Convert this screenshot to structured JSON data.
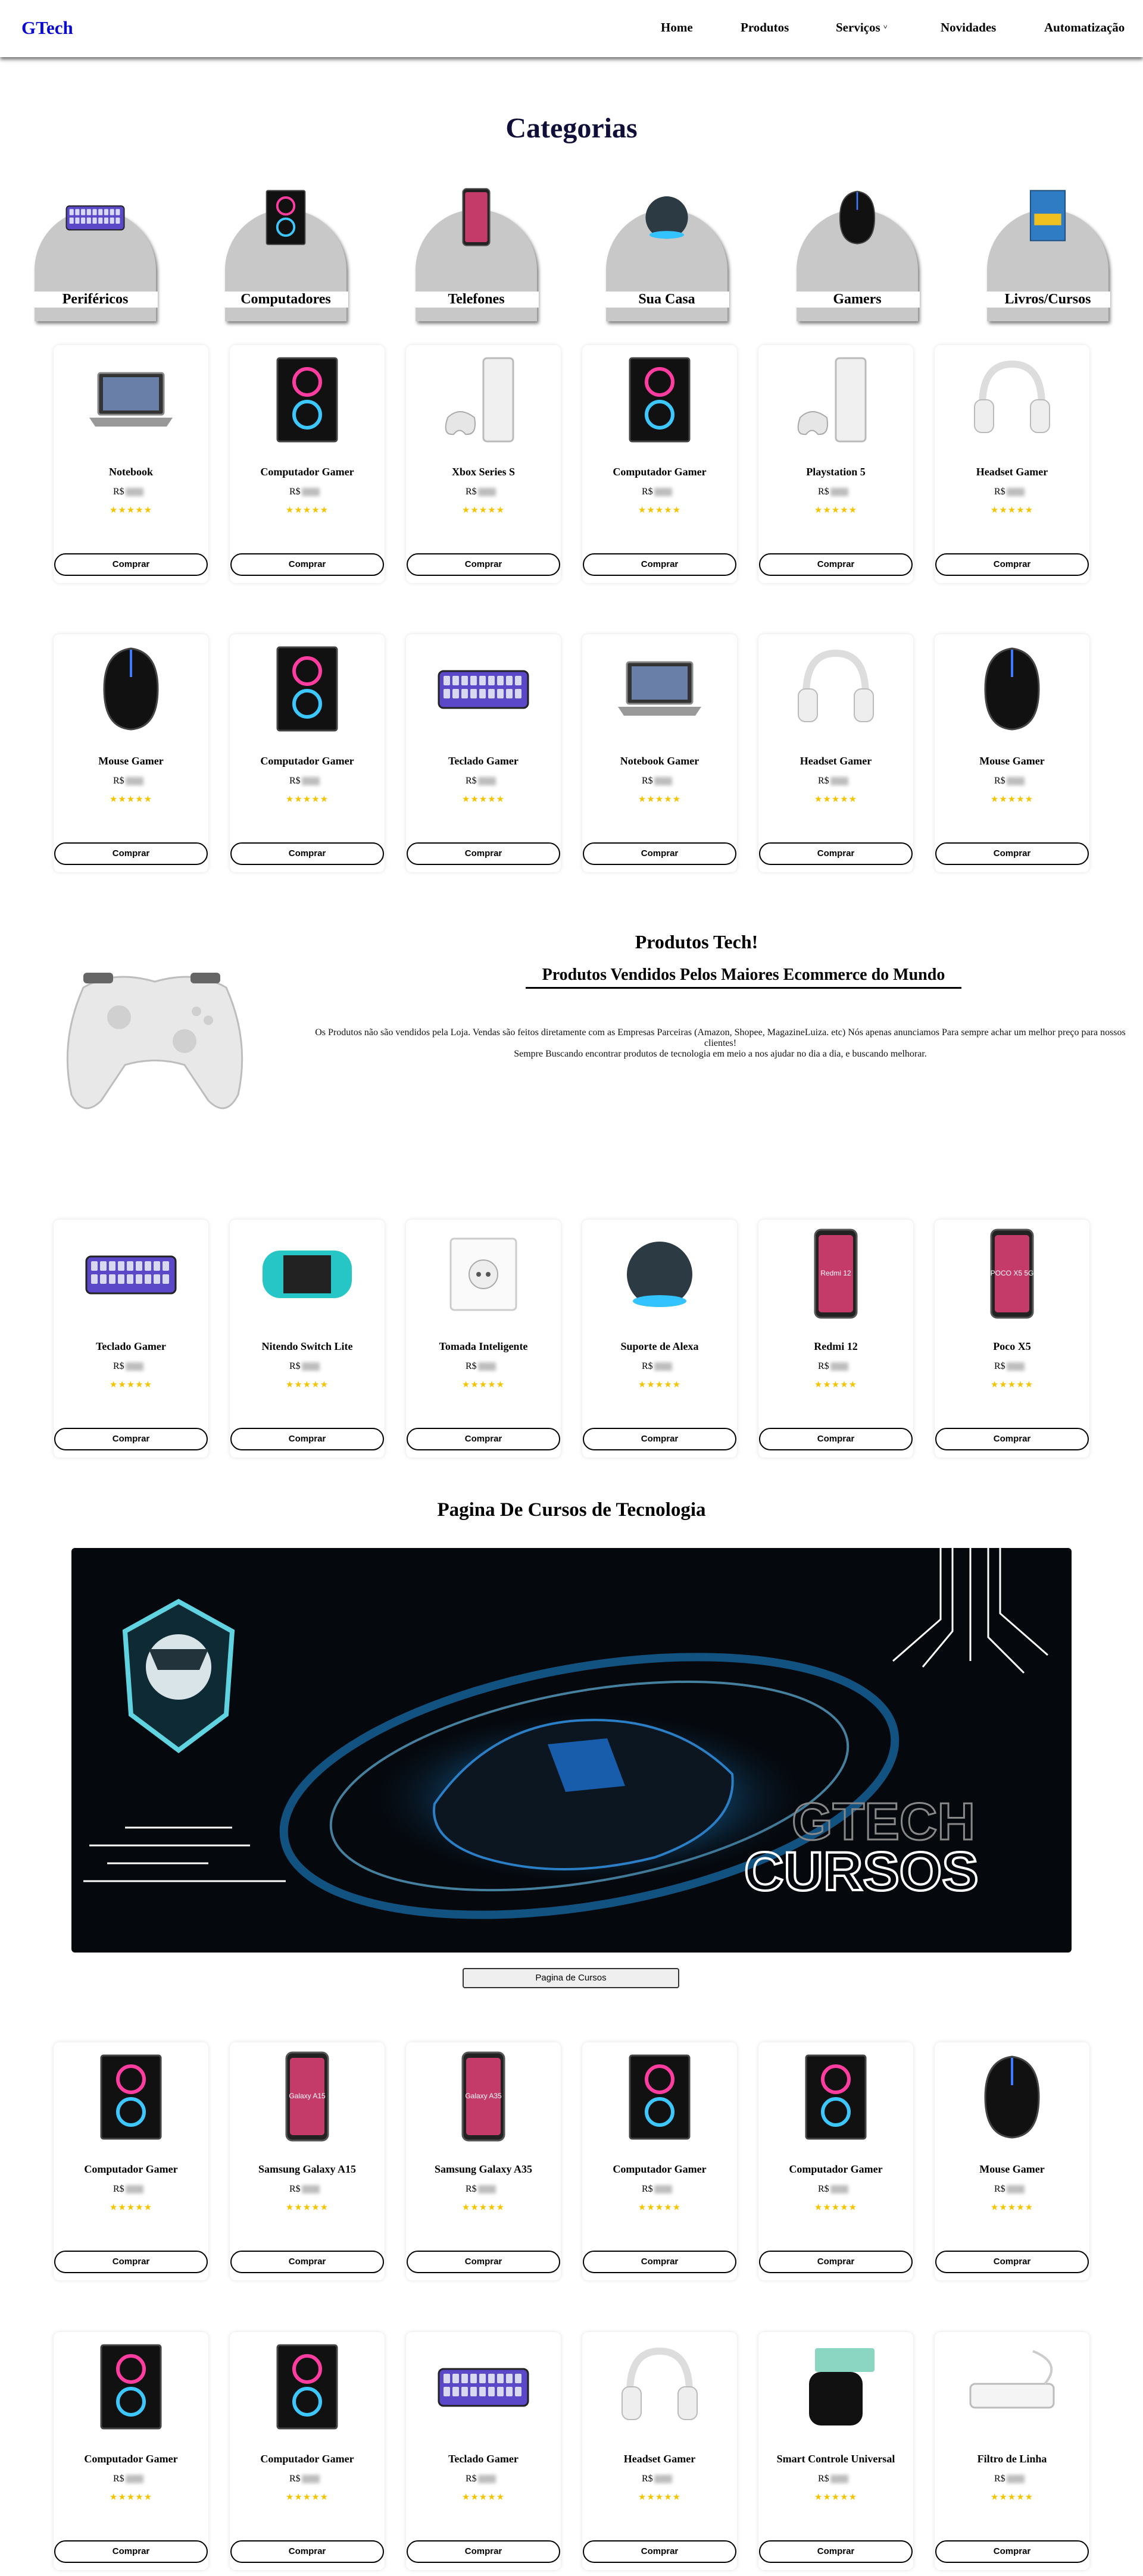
{
  "logo": {
    "initial": "G",
    "rest": "Tech"
  },
  "nav": [
    "Home",
    "Produtos",
    "Serviços",
    "Novidades",
    "Automatização"
  ],
  "categories_title": "Categorias",
  "categories": [
    {
      "label": "Periféricos",
      "icon": "keyboard-icon"
    },
    {
      "label": "Computadores",
      "icon": "pc-case-icon"
    },
    {
      "label": "Telefones",
      "icon": "smartphone-icon"
    },
    {
      "label": "Sua Casa",
      "icon": "smart-speaker-icon"
    },
    {
      "label": "Gamers",
      "icon": "mouse-icon"
    },
    {
      "label": "Livros/Cursos",
      "icon": "book-icon"
    }
  ],
  "price_prefix": "R$",
  "stars": "★★★★★",
  "buy_label": "Comprar",
  "products_row1": [
    {
      "name": "Notebook",
      "icon": "laptop"
    },
    {
      "name": "Computador Gamer",
      "icon": "pc"
    },
    {
      "name": "Xbox Series S",
      "icon": "console"
    },
    {
      "name": "Computador Gamer",
      "icon": "pc"
    },
    {
      "name": "Playstation 5",
      "icon": "console"
    },
    {
      "name": "Headset Gamer",
      "icon": "headset"
    }
  ],
  "products_row2": [
    {
      "name": "Mouse Gamer",
      "icon": "mouse"
    },
    {
      "name": "Computador Gamer",
      "icon": "pc"
    },
    {
      "name": "Teclado Gamer",
      "icon": "keyboard"
    },
    {
      "name": "Notebook Gamer",
      "icon": "laptop"
    },
    {
      "name": "Headset Gamer",
      "icon": "headset"
    },
    {
      "name": "Mouse Gamer",
      "icon": "mouse"
    }
  ],
  "tech": {
    "title": "Produtos Tech!",
    "subtitle": "Produtos Vendidos Pelos Maiores Ecommerce do Mundo",
    "line1": "Os Produtos não são vendidos pela Loja. Vendas são feitos diretamente com as Empresas Parceiras (Amazon, Shopee, MagazineLuiza. etc) Nós apenas anunciamos Para sempre achar um melhor preço para nossos clientes!",
    "line2": "Sempre Buscando encontrar produtos de tecnologia em meio a nos ajudar no dia a dia, e buscando melhorar."
  },
  "products_row3": [
    {
      "name": "Teclado Gamer",
      "icon": "keyboard"
    },
    {
      "name": "Nitendo Switch Lite",
      "icon": "switch"
    },
    {
      "name": "Tomada Inteligente",
      "icon": "socket"
    },
    {
      "name": "Suporte de Alexa",
      "icon": "speaker"
    },
    {
      "name": "Redmi 12",
      "icon": "phone",
      "screen": "Redmi 12"
    },
    {
      "name": "Poco X5",
      "icon": "phone",
      "screen": "POCO X5 5G"
    }
  ],
  "courses": {
    "title": "Pagina De Cursos de Tecnologia",
    "banner_line1": "GTECH",
    "banner_line2": "CURSOS",
    "button": "Pagina de Cursos"
  },
  "products_row4": [
    {
      "name": "Computador Gamer",
      "icon": "pc"
    },
    {
      "name": "Samsung Galaxy A15",
      "icon": "phone",
      "screen": "Galaxy A15"
    },
    {
      "name": "Samsung Galaxy A35",
      "icon": "phone",
      "screen": "Galaxy A35"
    },
    {
      "name": "Computador Gamer",
      "icon": "pc"
    },
    {
      "name": "Computador Gamer",
      "icon": "pc"
    },
    {
      "name": "Mouse Gamer",
      "icon": "mouse"
    }
  ],
  "products_row5": [
    {
      "name": "Computador Gamer",
      "icon": "pc"
    },
    {
      "name": "Computador Gamer",
      "icon": "pc"
    },
    {
      "name": "Teclado Gamer",
      "icon": "keyboard"
    },
    {
      "name": "Headset Gamer",
      "icon": "headset"
    },
    {
      "name": "Smart Controle Universal",
      "icon": "hub"
    },
    {
      "name": "Filtro de Linha",
      "icon": "powerstrip"
    }
  ],
  "colors": {
    "logo_accent": "#0a0ad0",
    "stars": "#f5c400",
    "category_bg": "#c8c8c8",
    "banner_bg": "#05080d",
    "banner_glow": "#1e8fe0"
  }
}
